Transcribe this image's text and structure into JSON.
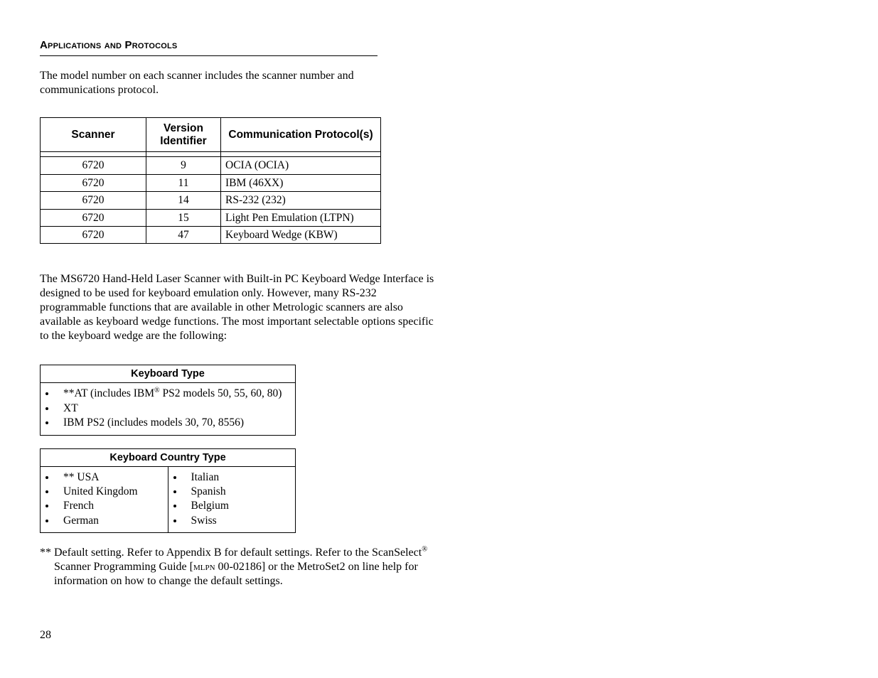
{
  "section_title": "Applications and Protocols",
  "intro": "The model number on each scanner includes the scanner number and communications protocol.",
  "protocol_table": {
    "headers": [
      "Scanner",
      "Version Identifier",
      "Communication Protocol(s)"
    ],
    "rows": [
      [
        "6720",
        "9",
        "OCIA (OCIA)"
      ],
      [
        "6720",
        "11",
        "IBM (46XX)"
      ],
      [
        "6720",
        "14",
        "RS-232 (232)"
      ],
      [
        "6720",
        "15",
        "Light Pen Emulation (LTPN)"
      ],
      [
        "6720",
        "47",
        "Keyboard Wedge (KBW)"
      ]
    ]
  },
  "paragraph2": "The MS6720 Hand-Held Laser Scanner with Built-in PC Keyboard Wedge Interface is designed to be used for keyboard emulation only.  However, many RS-232 programmable functions that are available in other Metrologic scanners are also available as keyboard wedge functions.  The most important selectable options specific to the keyboard wedge are the following:",
  "kbd_type": {
    "header": "Keyboard Type",
    "items_prefix": [
      "**AT (includes IBM",
      " PS2 models 50, 55, 60, 80)"
    ],
    "items_rest": [
      "XT",
      "IBM PS2 (includes models 30, 70, 8556)"
    ]
  },
  "kbd_country": {
    "header": "Keyboard Country Type",
    "left": [
      "** USA",
      "United Kingdom",
      "French",
      "German"
    ],
    "right": [
      "Italian",
      "Spanish",
      "Belgium",
      "Swiss"
    ]
  },
  "footnote": {
    "prefix": "** ",
    "part1": "Default setting.  Refer to Appendix B for default settings.  Refer to the ScanSelect",
    "part2": " Scanner Programming Guide [",
    "mlpn": "mlpn",
    "part3": " 00-02186] or the MetroSet2 on line help for information on how to change the default settings."
  },
  "page_number": "28"
}
